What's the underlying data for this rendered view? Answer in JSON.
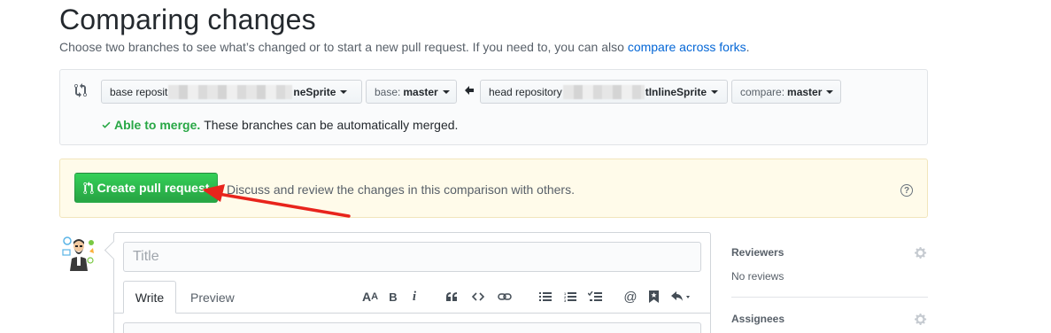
{
  "page": {
    "title": "Comparing changes",
    "description": "Choose two branches to see what’s changed or to start a new pull request. If you need to, you can also ",
    "description_link": "compare across forks",
    "description_end": "."
  },
  "range": {
    "base_repo_prefix": "base reposit",
    "base_repo_suffix": "neSprite",
    "base_branch_label": "base:",
    "base_branch_value": "master",
    "head_repo_prefix": "head repository",
    "head_repo_suffix": "tInlineSprite",
    "compare_label": "compare:",
    "compare_value": "master"
  },
  "merge": {
    "status_bold": "Able to merge.",
    "status_text": "These branches can be automatically merged."
  },
  "flash": {
    "button_label": "Create pull request",
    "description": "Discuss and review the changes in this comparison with others."
  },
  "composer": {
    "title_placeholder": "Title",
    "tab_write": "Write",
    "tab_preview": "Preview",
    "toolbar_icons": [
      "text-size-icon",
      "bold-icon",
      "italic-icon",
      "quote-icon",
      "code-icon",
      "link-icon",
      "bulleted-list-icon",
      "numbered-list-icon",
      "task-list-icon",
      "mention-icon",
      "bookmark-icon",
      "reply-icon"
    ]
  },
  "sidebar": {
    "reviewers_heading": "Reviewers",
    "reviewers_value": "No reviews",
    "assignees_heading": "Assignees"
  },
  "colors": {
    "accent_green": "#28a745",
    "link_blue": "#0366d6",
    "annotation_red": "#e8241c",
    "flash_bg": "#fffbea"
  }
}
